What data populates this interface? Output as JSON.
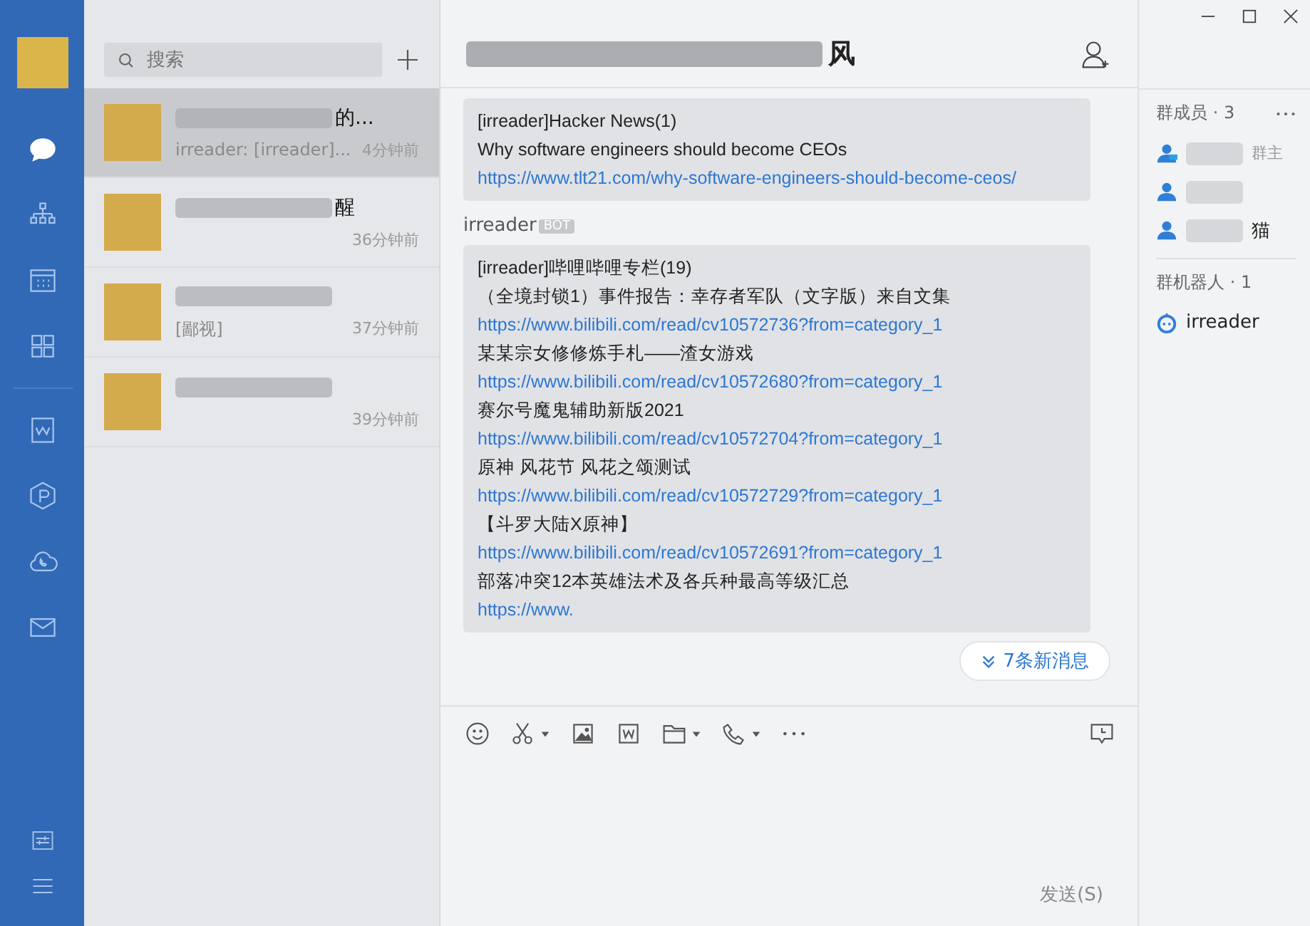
{
  "sidebar": {
    "items": [
      {
        "kind": "chat",
        "selected": true
      },
      {
        "kind": "org",
        "selected": false
      },
      {
        "kind": "calendar",
        "selected": false
      },
      {
        "kind": "apps",
        "selected": false
      },
      {
        "kind": "doc",
        "selected": false
      },
      {
        "kind": "drive",
        "selected": false
      },
      {
        "kind": "meeting",
        "selected": false
      },
      {
        "kind": "mail",
        "selected": false
      }
    ],
    "bottom_items": [
      {
        "kind": "settings"
      },
      {
        "kind": "menu"
      }
    ]
  },
  "search": {
    "placeholder": "搜索"
  },
  "conversations": [
    {
      "title": "的...",
      "preview": "irreader: [irreader]...",
      "time": "4分钟前",
      "selected": true
    },
    {
      "title": "醒",
      "time": "36分钟前",
      "selected": false
    },
    {
      "preview": "[鄙视]",
      "time": "37分钟前",
      "selected": false
    },
    {
      "time": "39分钟前",
      "selected": false
    }
  ],
  "chat": {
    "title": "风",
    "messages": [
      {
        "title": "[irreader]Hacker News(1)",
        "items": [
          {
            "text": "Why software engineers should become CEOs",
            "link": "https://www.tlt21.com/why-software-engineers-should-become-ceos/"
          }
        ]
      },
      {
        "sender": "irreader",
        "badge": "BOT",
        "title": "[irreader]哔哩哔哩专栏(19)",
        "items": [
          {
            "text": "（全境封锁1）事件报告：幸存者军队（文字版）来自文集",
            "link": "https://www.bilibili.com/read/cv10572736?from=category_1"
          },
          {
            "text": "某某宗女修修炼手札——渣女游戏",
            "link": "https://www.bilibili.com/read/cv10572680?from=category_1"
          },
          {
            "text": "赛尔号魔鬼辅助新版2021",
            "link": "https://www.bilibili.com/read/cv10572704?from=category_1"
          },
          {
            "text": "原神 风花节 风花之颂测试",
            "link": "https://www.bilibili.com/read/cv10572729?from=category_1"
          },
          {
            "text": "【斗罗大陆X原神】",
            "link": "https://www.bilibili.com/read/cv10572691?from=category_1"
          },
          {
            "text": "部落冲突12本英雄法术及各兵种最高等级汇总",
            "link": "https://www."
          }
        ]
      }
    ],
    "new_messages": "7条新消息",
    "toolbar": [
      {
        "kind": "emoji"
      },
      {
        "kind": "scissors",
        "dropdown": true
      },
      {
        "kind": "image"
      },
      {
        "kind": "doc"
      },
      {
        "kind": "folder",
        "dropdown": true
      },
      {
        "kind": "phone",
        "dropdown": true
      },
      {
        "kind": "more"
      }
    ],
    "send_button": "发送(S)"
  },
  "members": {
    "heading": "群成员 · 3",
    "list": [
      {
        "kind": "owner",
        "name": "群主"
      },
      {
        "kind": "member"
      },
      {
        "kind": "member",
        "name": "猫"
      }
    ],
    "bots_heading": "群机器人 · 1",
    "bots": [
      {
        "name": "irreader"
      }
    ]
  }
}
